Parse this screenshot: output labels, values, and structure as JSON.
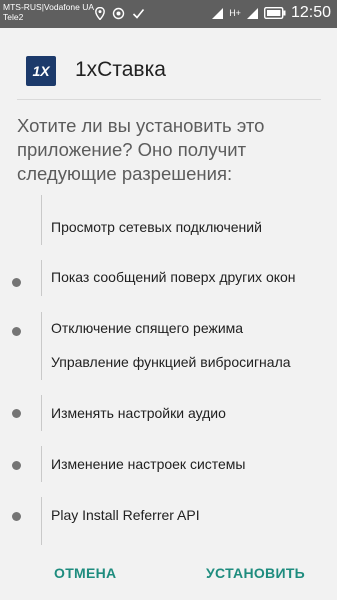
{
  "status_bar": {
    "carrier_1": "MTS-RUS|Vodafone UA",
    "carrier_2": "Tele2",
    "time": "12:50",
    "network_type": "H+"
  },
  "dialog": {
    "app_icon_text": "1X",
    "app_name": "1xСтавка",
    "prompt": "Хотите ли вы установить это приложение? Оно получит следующие разрешения:",
    "permissions": [
      "Просмотр сетевых подключений",
      "Показ сообщений поверх других окон",
      "Отключение спящего режима",
      "Управление функцией вибросигнала",
      "Изменять настройки аудио",
      "Изменение настроек системы",
      "Play Install Referrer API"
    ],
    "cancel_label": "ОТМЕНА",
    "install_label": "УСТАНОВИТЬ"
  }
}
